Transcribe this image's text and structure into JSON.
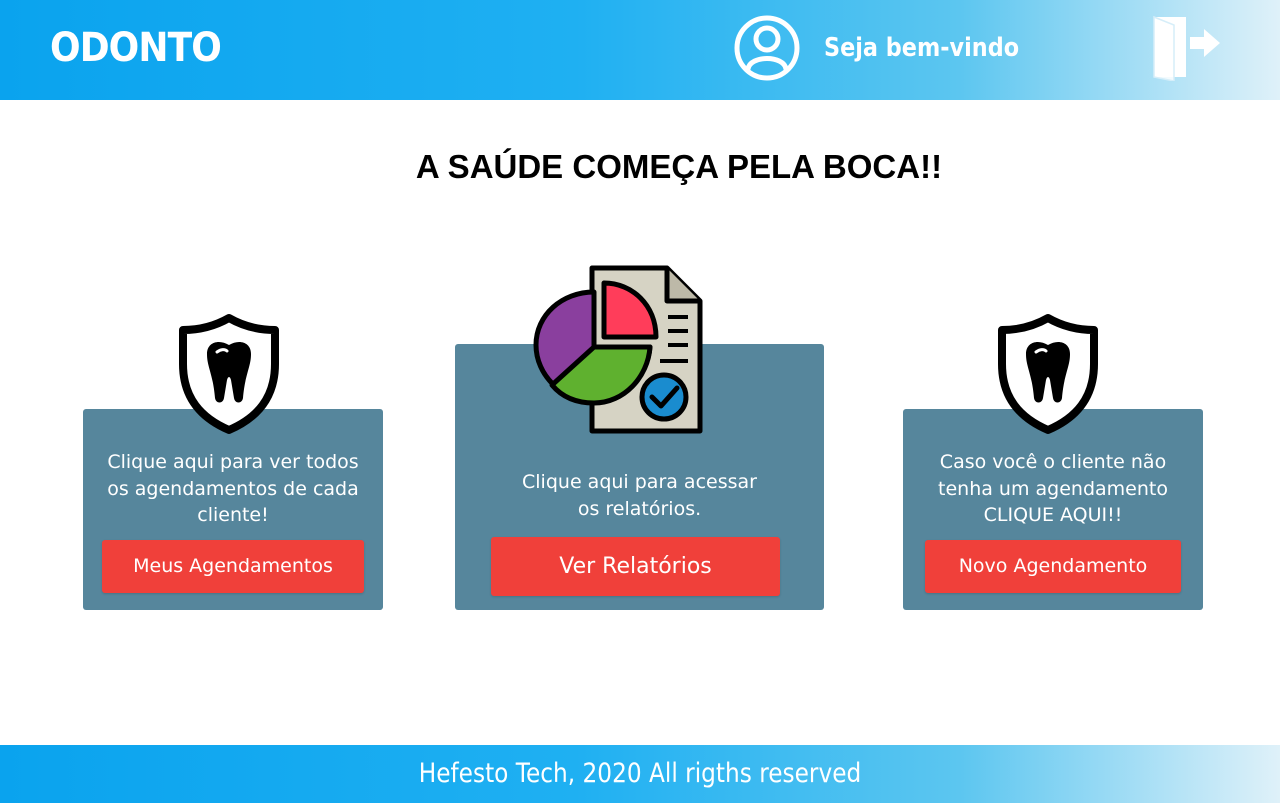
{
  "header": {
    "brand": "ODONTO",
    "welcome": "Seja bem-vindo",
    "user_icon": "user-circle-icon",
    "logout_icon": "logout-icon"
  },
  "main": {
    "headline": "A SAÚDE COMEÇA PELA BOCA!!",
    "cards": [
      {
        "icon": "tooth-shield-icon",
        "text": "Clique aqui para ver todos\nos agendamentos de cada\ncliente!",
        "button": "Meus Agendamentos"
      },
      {
        "icon": "report-chart-icon",
        "text": "Clique aqui para acessar\nos relatórios.",
        "button": "Ver Relatórios"
      },
      {
        "icon": "tooth-shield-icon",
        "text": "Caso você o cliente não\ntenha um agendamento\nCLIQUE AQUI!!",
        "button": "Novo Agendamento"
      }
    ]
  },
  "footer": {
    "text": "Hefesto Tech, 2020 All rigths reserved"
  },
  "colors": {
    "header_gradient_start": "#0aa3ee",
    "header_gradient_end": "#dff1f9",
    "card": "#56869c",
    "button": "#f0403a"
  }
}
